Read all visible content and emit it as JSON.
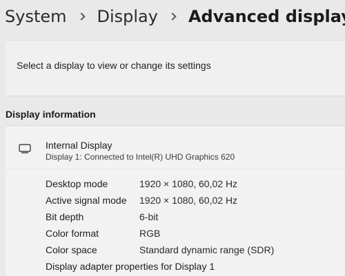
{
  "breadcrumb": {
    "items": [
      "System",
      "Display",
      "Advanced display"
    ]
  },
  "select_display": {
    "label": "Select a display to view or change its settings"
  },
  "display_information": {
    "title": "Display information",
    "display_name": "Internal Display",
    "display_subtitle": "Display 1: Connected to Intel(R) UHD Graphics 620",
    "icon": "monitor-icon",
    "rows": [
      {
        "key": "Desktop mode",
        "value": "1920 × 1080, 60,02 Hz"
      },
      {
        "key": "Active signal mode",
        "value": "1920 × 1080, 60,02 Hz"
      },
      {
        "key": "Bit depth",
        "value": "6-bit"
      },
      {
        "key": "Color format",
        "value": "RGB"
      },
      {
        "key": "Color space",
        "value": "Standard dynamic range (SDR)"
      }
    ],
    "adapter_link": "Display adapter properties for Display 1"
  }
}
